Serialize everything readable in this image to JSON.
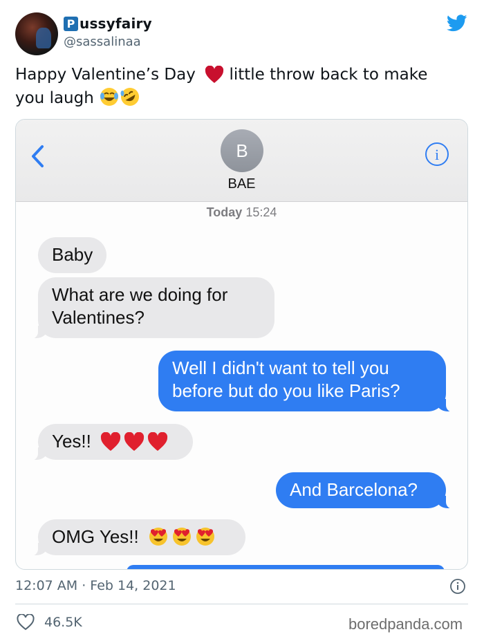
{
  "author": {
    "badge_letter": "P",
    "display_name": "ussyfairy",
    "handle": "@sassalinaa"
  },
  "tweet": {
    "text_part1": "Happy Valentine’s Day",
    "text_part2": " little throw back to make you laugh ",
    "timestamp": "12:07 AM · Feb 14, 2021",
    "likes": "46.5K"
  },
  "screenshot": {
    "contact_initial": "B",
    "contact_name": "BAE",
    "date_label": "Today",
    "time_label": "15:24",
    "messages": [
      {
        "from": "them",
        "text": "Baby"
      },
      {
        "from": "them",
        "text": "What are we doing for Valentines?"
      },
      {
        "from": "me",
        "text": "Well I didn't want to tell you before but do you like Paris?"
      },
      {
        "from": "them",
        "text": "Yes!!",
        "emoji": "red-heart x3"
      },
      {
        "from": "me",
        "text": "And Barcelona?"
      },
      {
        "from": "them",
        "text": "OMG Yes!!",
        "emoji": "heart-eyes x3"
      }
    ]
  },
  "watermark": "boredpanda.com",
  "colors": {
    "twitter_blue": "#1d9bf0",
    "imessage_blue": "#2f7df2",
    "received_gray": "#e8e8ea",
    "badge_blue": "#1f6fb2"
  },
  "icons": [
    "twitter-bird-icon",
    "heart-emoji",
    "laughing-emoji",
    "rofl-emoji",
    "back-chevron-icon",
    "info-icon",
    "like-heart-icon"
  ]
}
